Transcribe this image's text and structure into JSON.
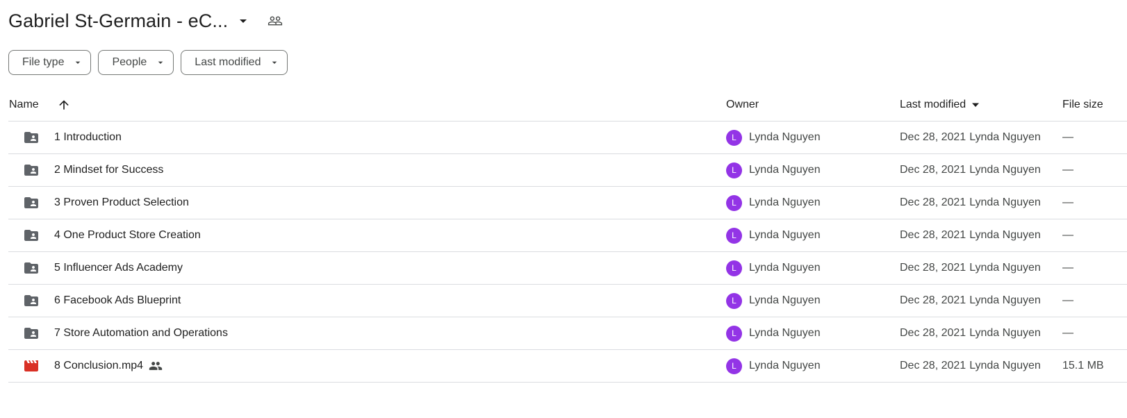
{
  "header": {
    "folder_title": "Gabriel St-Germain - eC...",
    "title_caret_icon": "arrow-drop-down-icon",
    "shared_icon": "people-outline-icon"
  },
  "filters": [
    {
      "label": "File type"
    },
    {
      "label": "People"
    },
    {
      "label": "Last modified"
    }
  ],
  "table": {
    "columns": {
      "name": "Name",
      "owner": "Owner",
      "last_modified": "Last modified",
      "file_size": "File size"
    },
    "sort_icon": "arrow-upward-icon",
    "rows": [
      {
        "name": "1 Introduction",
        "type": "shared-folder",
        "owner_initial": "L",
        "owner": "Lynda Nguyen",
        "modified_date": "Dec 28, 2021",
        "modified_by": "Lynda Nguyen",
        "size": "—",
        "shared": false
      },
      {
        "name": "2 Mindset for Success",
        "type": "shared-folder",
        "owner_initial": "L",
        "owner": "Lynda Nguyen",
        "modified_date": "Dec 28, 2021",
        "modified_by": "Lynda Nguyen",
        "size": "—",
        "shared": false
      },
      {
        "name": "3 Proven Product Selection",
        "type": "shared-folder",
        "owner_initial": "L",
        "owner": "Lynda Nguyen",
        "modified_date": "Dec 28, 2021",
        "modified_by": "Lynda Nguyen",
        "size": "—",
        "shared": false
      },
      {
        "name": "4 One Product Store Creation",
        "type": "shared-folder",
        "owner_initial": "L",
        "owner": "Lynda Nguyen",
        "modified_date": "Dec 28, 2021",
        "modified_by": "Lynda Nguyen",
        "size": "—",
        "shared": false
      },
      {
        "name": "5 Influencer Ads Academy",
        "type": "shared-folder",
        "owner_initial": "L",
        "owner": "Lynda Nguyen",
        "modified_date": "Dec 28, 2021",
        "modified_by": "Lynda Nguyen",
        "size": "—",
        "shared": false
      },
      {
        "name": "6 Facebook Ads Blueprint",
        "type": "shared-folder",
        "owner_initial": "L",
        "owner": "Lynda Nguyen",
        "modified_date": "Dec 28, 2021",
        "modified_by": "Lynda Nguyen",
        "size": "—",
        "shared": false
      },
      {
        "name": "7 Store Automation and Operations",
        "type": "shared-folder",
        "owner_initial": "L",
        "owner": "Lynda Nguyen",
        "modified_date": "Dec 28, 2021",
        "modified_by": "Lynda Nguyen",
        "size": "—",
        "shared": false
      },
      {
        "name": "8 Conclusion.mp4",
        "type": "video",
        "owner_initial": "L",
        "owner": "Lynda Nguyen",
        "modified_date": "Dec 28, 2021",
        "modified_by": "Lynda Nguyen",
        "size": "15.1 MB",
        "shared": true
      }
    ]
  },
  "colors": {
    "avatar": "#9334e6",
    "folder_icon": "#5f6368",
    "video_icon": "#d93025",
    "divider": "#dadce0",
    "chip_border": "#747775"
  }
}
